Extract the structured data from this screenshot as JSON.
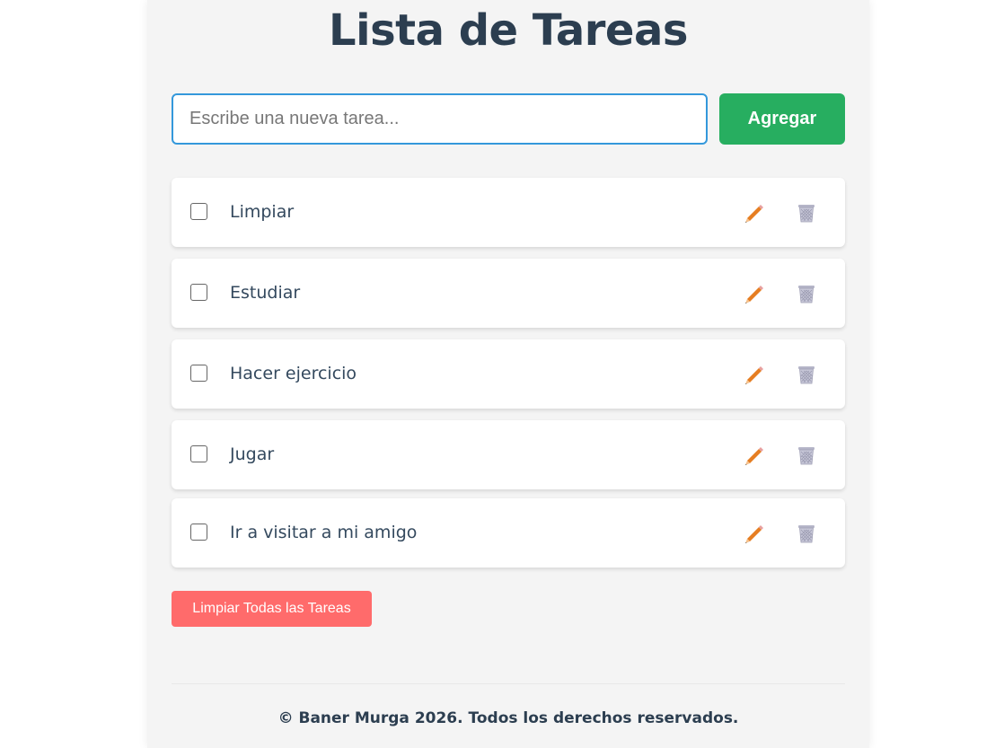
{
  "app": {
    "title": "Lista de Tareas"
  },
  "input": {
    "value": "",
    "placeholder": "Escribe una nueva tarea...",
    "add_label": "Agregar"
  },
  "tasks": [
    {
      "text": "Limpiar",
      "done": false
    },
    {
      "text": "Estudiar",
      "done": false
    },
    {
      "text": "Hacer ejercicio",
      "done": false
    },
    {
      "text": "Jugar",
      "done": false
    },
    {
      "text": "Ir a visitar a mi amigo",
      "done": false
    }
  ],
  "icons": {
    "edit": "pencil-icon",
    "delete": "wastebasket-icon"
  },
  "actions": {
    "clear_all_label": "Limpiar Todas las Tareas"
  },
  "footer": {
    "text": "© Baner Murga 2026. Todos los derechos reservados."
  },
  "colors": {
    "title": "#2c3e50",
    "input_border": "#3498db",
    "add_button": "#27ae60",
    "clear_button": "#ff6b6b",
    "edit_icon": "#e67e22",
    "delete_icon": "#a9a9c0"
  }
}
